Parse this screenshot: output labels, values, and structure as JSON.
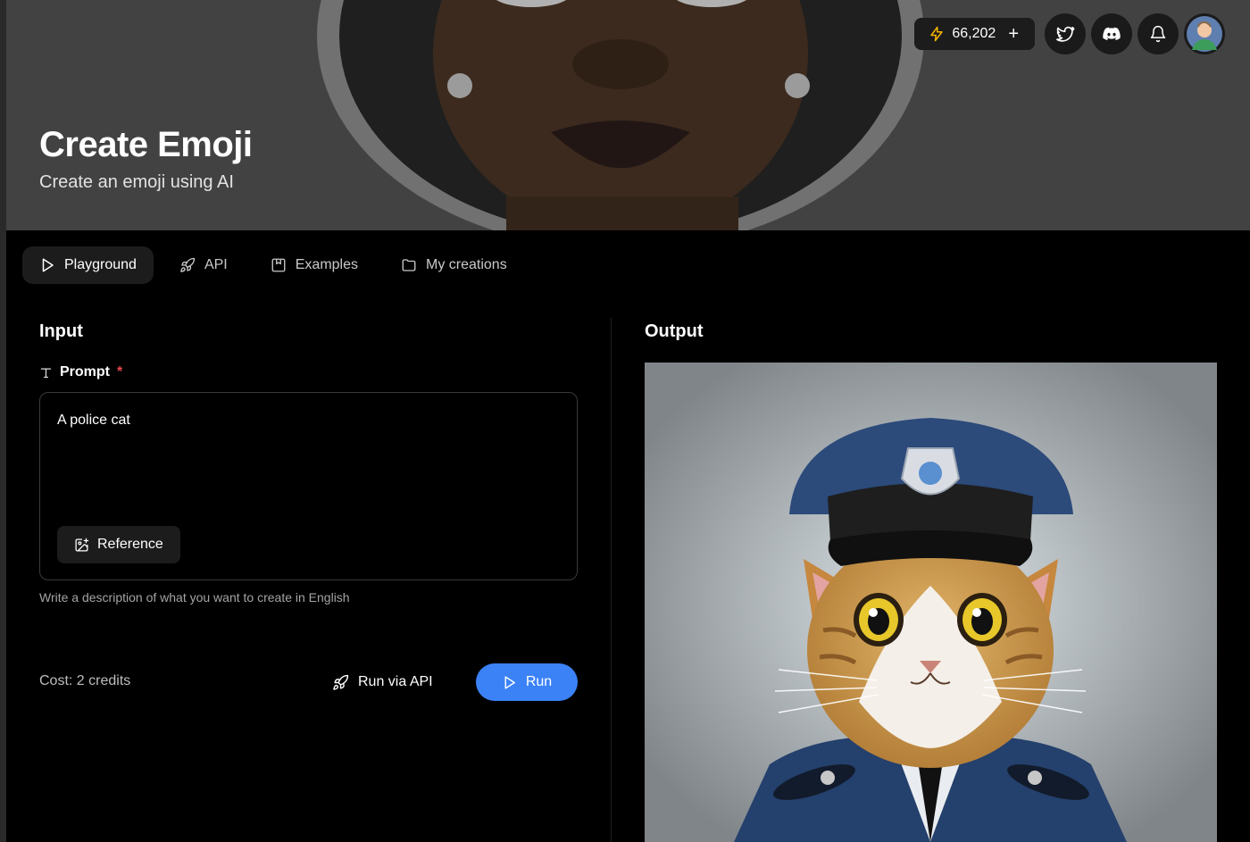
{
  "hero": {
    "title": "Create Emoji",
    "subtitle": "Create an emoji using AI"
  },
  "topbar": {
    "credits": "66,202",
    "credits_add": "+",
    "icons": [
      "lightning-icon",
      "twitter-icon",
      "discord-icon",
      "bell-icon",
      "avatar"
    ]
  },
  "tabs": [
    {
      "label": "Playground",
      "icon": "play-icon",
      "active": true
    },
    {
      "label": "API",
      "icon": "rocket-icon",
      "active": false
    },
    {
      "label": "Examples",
      "icon": "bookmark-icon",
      "active": false
    },
    {
      "label": "My creations",
      "icon": "folder-icon",
      "active": false
    }
  ],
  "input": {
    "title": "Input",
    "prompt_label": "Prompt",
    "required_mark": "*",
    "prompt_value": "A police cat",
    "reference_label": "Reference",
    "helper_text": "Write a description of what you want to create in English",
    "cost_text": "Cost: 2 credits",
    "run_api_label": "Run via API",
    "run_label": "Run"
  },
  "output": {
    "title": "Output"
  },
  "colors": {
    "accent": "#3b82f6",
    "required": "#e5484d",
    "background": "#000000",
    "surface": "#1c1c1c"
  }
}
